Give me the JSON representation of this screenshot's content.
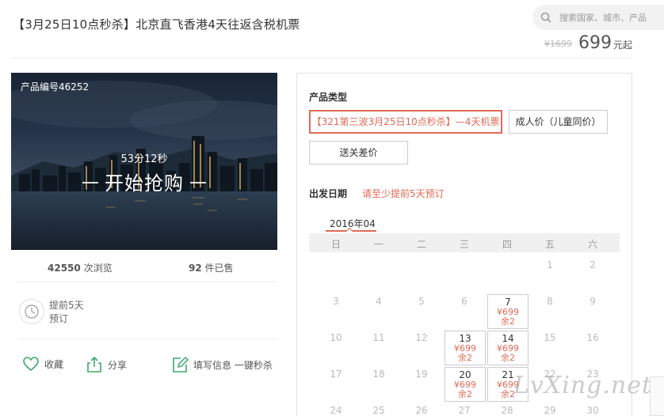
{
  "product": {
    "title": "【3月25日10点秒杀】北京直飞香港4天往返含税机票",
    "price_old": "¥1699",
    "price_now": "699",
    "price_unit": "元起"
  },
  "search": {
    "placeholder": "搜索国家、城市、产品"
  },
  "hero": {
    "product_code": "产品编号46252",
    "countdown": "53分12秒",
    "cta": "开始抢购"
  },
  "stats": {
    "views_count": "42550",
    "views_label": "次浏览",
    "sold_count": "92",
    "sold_label": "件已售"
  },
  "advance": {
    "line1": "提前5天",
    "line2": "预订"
  },
  "actions": {
    "favorite": "收藏",
    "share": "分享",
    "fill_info": "填写信息 一键秒杀"
  },
  "booking": {
    "product_type_label": "产品类型",
    "options": [
      "【321第三波3月25日10点秒杀】—4天机票",
      "成人价（儿童同价）",
      "送关差价"
    ],
    "date_label": "出发日期",
    "date_hint": "请至少提前5天预订"
  },
  "calendar": {
    "month": "2016年04",
    "weekdays": [
      "日",
      "一",
      "二",
      "三",
      "四",
      "五",
      "六"
    ],
    "rows": [
      [
        "",
        "",
        "",
        "",
        "",
        "1",
        "2"
      ],
      [
        "3",
        "4",
        "5",
        "6",
        "7",
        "8",
        "9"
      ],
      [
        "10",
        "11",
        "12",
        "13",
        "14",
        "15",
        "16"
      ],
      [
        "17",
        "18",
        "19",
        "20",
        "21",
        "22",
        "23"
      ],
      [
        "24",
        "25",
        "26",
        "27",
        "28",
        "29",
        "30"
      ]
    ],
    "available": {
      "7": {
        "price": "¥699",
        "remain": "余2"
      },
      "13": {
        "price": "¥699",
        "remain": "余2"
      },
      "14": {
        "price": "¥699",
        "remain": "余2"
      },
      "20": {
        "price": "¥699",
        "remain": "余2"
      },
      "21": {
        "price": "¥699",
        "remain": "余2"
      }
    }
  },
  "watermark": "LvXing.net",
  "colors": {
    "accent": "#e06a55",
    "icon_green": "#3aaa6d"
  }
}
